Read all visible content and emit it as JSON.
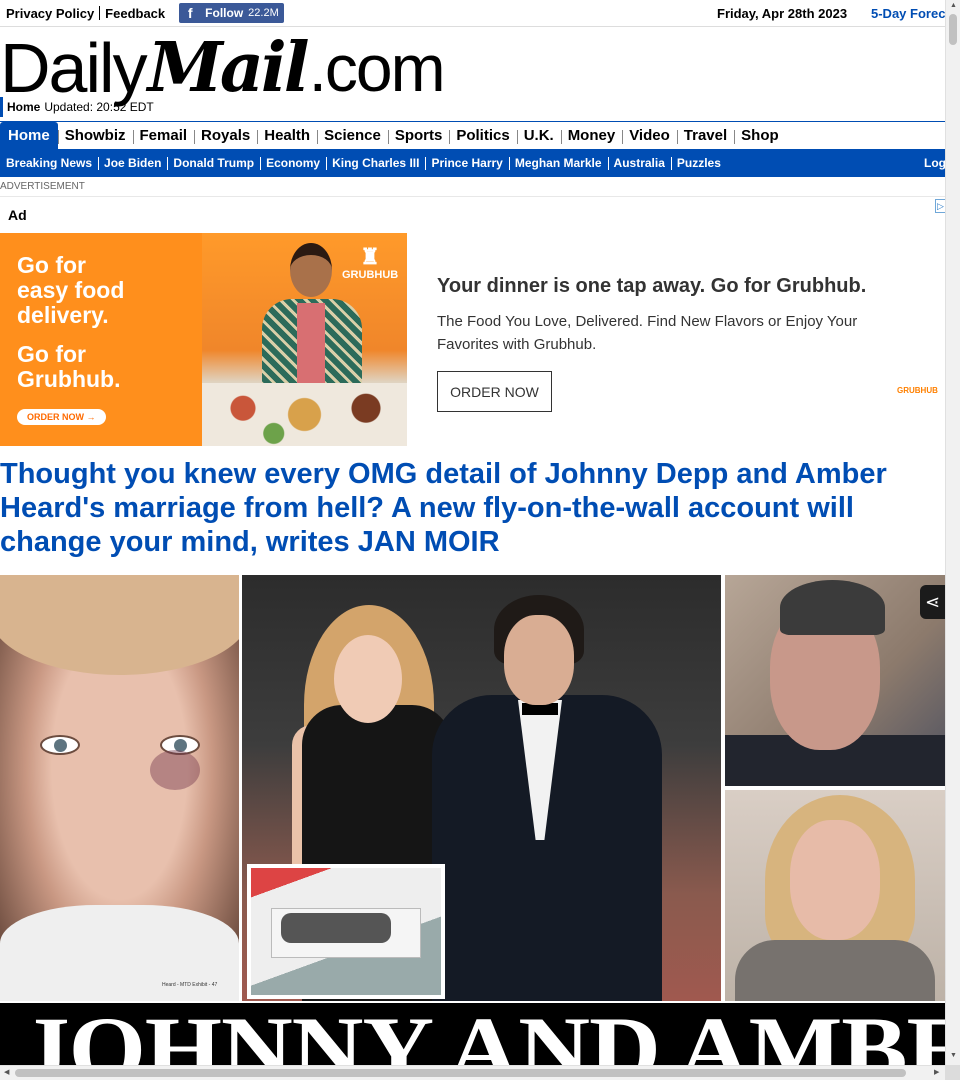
{
  "topbar": {
    "privacy": "Privacy Policy",
    "feedback": "Feedback",
    "follow_label": "Follow",
    "follow_count": "22.2M",
    "date": "Friday, Apr 28th 2023",
    "forecast": "5-Day Forec"
  },
  "masthead": {
    "logo_daily": "Daily",
    "logo_mail": "Mail",
    "logo_com": ".com",
    "home": "Home",
    "updated": "Updated: 20:52 EDT"
  },
  "nav_primary": {
    "home": "Home",
    "showbiz": "Showbiz",
    "femail": "Femail",
    "royals": "Royals",
    "health": "Health",
    "science": "Science",
    "sports": "Sports",
    "politics": "Politics",
    "uk": "U.K.",
    "money": "Money",
    "video": "Video",
    "travel": "Travel",
    "shop": "Shop"
  },
  "nav_secondary": {
    "breaking": "Breaking News",
    "biden": "Joe Biden",
    "trump": "Donald Trump",
    "economy": "Economy",
    "charles": "King Charles III",
    "harry": "Prince Harry",
    "meghan": "Meghan Markle",
    "australia": "Australia",
    "puzzles": "Puzzles",
    "login": "Log"
  },
  "advertisement_label": "ADVERTISEMENT",
  "ad": {
    "tag": "Ad",
    "image_line1": "Go for",
    "image_line2": "easy food",
    "image_line3": "delivery.",
    "image_line4": "Go for",
    "image_line5": "Grubhub.",
    "image_button": "ORDER NOW →",
    "image_brand": "GRUBHUB",
    "headline": "Your dinner is one tap away. Go for Grubhub.",
    "body": "The Food You Love, Delivered. Find New Flavors or Enjoy Your Favorites with Grubhub.",
    "cta": "ORDER NOW",
    "brand_small": "GRUBHUB"
  },
  "article": {
    "headline": "Thought you knew every OMG detail of Johnny Depp and Amber Heard's marriage from hell? A new fly-on-the-wall account will change your mind, writes JAN MOIR",
    "image_caption_small": "Heard - MTD Exhibit - 47",
    "banner_text": "JOHNNY AND AMBER EXPOSED"
  },
  "colors": {
    "brand_blue": "#004db3",
    "grubhub_orange": "#ff8f1c",
    "facebook_blue": "#3b5998"
  },
  "icons": {
    "facebook": "facebook-icon",
    "share": "share-icon",
    "adchoices": "adchoices-icon"
  }
}
